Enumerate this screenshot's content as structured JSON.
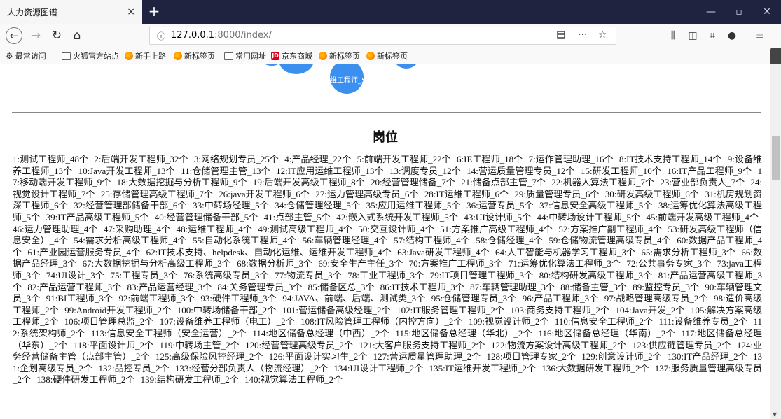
{
  "browser": {
    "tab_title": "人力资源图谱",
    "tab_close": "×",
    "new_tab": "+",
    "url_host": "127.0.0.1",
    "url_path": ":8000/index/",
    "window_min": "—",
    "window_restore": "▫",
    "window_close": "✕"
  },
  "bookmarks": [
    {
      "label": "最常访问",
      "icon": "gear-icon"
    },
    {
      "label": "火狐官方站点",
      "icon": "folder-icon"
    },
    {
      "label": "新手上路",
      "icon": "firefox-icon"
    },
    {
      "label": "新标签页",
      "icon": "firefox-icon"
    },
    {
      "label": "常用网址",
      "icon": "folder-icon"
    },
    {
      "label": "京东商城",
      "icon": "jd-icon"
    },
    {
      "label": "新标签页",
      "icon": "firefox-icon"
    },
    {
      "label": "新标签页",
      "icon": "firefox-icon"
    }
  ],
  "graph": {
    "node_label": "IT运维工程师_5个"
  },
  "section": {
    "title": "岗位"
  },
  "jobs": [
    "1:测试工程师_48个",
    "2:后端开发工程师_32个",
    "3:网络规划专员_25个",
    "4:产品经理_22个",
    "5:前端开发工程师_22个",
    "6:IE工程师_18个",
    "7:运作管理助理_16个",
    "8:IT技术支持工程师_14个",
    "9:设备维养工程师_13个",
    "10:Java开发工程师_13个",
    "11:仓储管理主管_13个",
    "12:IT应用运维工程师_13个",
    "13:调度专员_12个",
    "14:营运质量管理专员_12个",
    "15:研发工程师_10个",
    "16:IT产品工程师_9个",
    "17:移动端开发工程师_9个",
    "18:大数据挖掘与分析工程师_9个",
    "19:后端开发高级工程师_8个",
    "20:经营管理储备_7个",
    "21:储备点部主管_7个",
    "22:机器人算法工程师_7个",
    "23:营业部负责人_7个",
    "24:视觉设计工程师_7个",
    "25:存储管理高级工程师_7个",
    "26:java开发工程师_6个",
    "27:运力管理高级专员_6个",
    "28:IT运维工程师_6个",
    "29:质量管理专员_6个",
    "30:研发高级工程师_6个",
    "31:机房规划资深工程师_6个",
    "32:经营管理部储备干部_6个",
    "33:中转场经理_5个",
    "34:仓储管理经理_5个",
    "35:应用运维工程师_5个",
    "36:运营专员_5个",
    "37:信息安全高级工程师_5个",
    "38:运筹优化算法高级工程师_5个",
    "39:IT产品高级工程师_5个",
    "40:经营管理储备干部_5个",
    "41:点部主管_5个",
    "42:嵌入式系统开发工程师_5个",
    "43:UI设计师_5个",
    "44:中转场设计工程师_5个",
    "45:前端开发高级工程师_4个",
    "46:运力管理助理_4个",
    "47:采购助理_4个",
    "48:运维工程师_4个",
    "49:测试高级工程师_4个",
    "50:交互设计师_4个",
    "51:方案推广高级工程师_4个",
    "52:方案推广副工程师_4个",
    "53:研发高级工程师（信息安全）_4个",
    "54:需求分析高级工程师_4个",
    "55:自动化系统工程师_4个",
    "56:车辆管理经理_4个",
    "57:结构工程师_4个",
    "58:仓储经理_4个",
    "59:仓储物流管理高级专员_4个",
    "60:数据产品工程师_4个",
    "61:产业园运营服务专员_4个",
    "62:IT技术支持、helpdesk、自动化运维、运维开发工程师_4个",
    "63:Java研发工程师_4个",
    "64:人工智能与机器学习工程师_3个",
    "65:需求分析工程师_3个",
    "66:数据产品经理_3个",
    "67:大数据挖掘与分析高级工程师_3个",
    "68:数据分析师_3个",
    "69:安全生产主任_3个",
    "70:方案推广工程师_3个",
    "71:运筹优化算法工程师_3个",
    "72:公共事务专家_3个",
    "73:java工程师_3个",
    "74:UI设计_3个",
    "75:工程专员_3个",
    "76:系统高级专员_3个",
    "77:物流专员_3个",
    "78:工业工程师_3个",
    "79:IT项目管理工程师_3个",
    "80:结构研发高级工程师_3个",
    "81:产品运营高级工程师_3个",
    "82:产品运营工程师_3个",
    "83:产品运营经理_3个",
    "84:关务管理专员_3个",
    "85:储备区总_3个",
    "86:IT技术工程师_3个",
    "87:车辆管理助理_3个",
    "88:储备主管_3个",
    "89:监控专员_3个",
    "90:车辆管理文员_3个",
    "91:BI工程师_3个",
    "92:前端工程师_3个",
    "93:硬件工程师_3个",
    "94:JAVA、前端、后端、测试类_3个",
    "95:仓储管理专员_3个",
    "96:产品工程师_3个",
    "97:战略管理高级专员_2个",
    "98:造价高级工程师_2个",
    "99:Android开发工程师_2个",
    "100:中转场储备干部_2个",
    "101:营运储备高级经理_2个",
    "102:IT服务管理工程师_2个",
    "103:商务支持工程师_2个",
    "104:Java开发_2个",
    "105:解决方案高级工程师_2个",
    "106:项目管理总监_2个",
    "107:设备维养工程师（电工）_2个",
    "108:IT风险管理工程师（内控方向）_2个",
    "109:视觉设计师_2个",
    "110:信息安全工程师_2个",
    "111:设备维养专员_2个",
    "112:系统架构师_2个",
    "113:信息安全工程师（安全运营）_2个",
    "114:地区储备总经理（中西）_2个",
    "115:地区储备总经理（华北）_2个",
    "116:地区储备总经理（华南）_2个",
    "117:地区储备总经理（华东）_2个",
    "118:平面设计师_2个",
    "119:中转场主管_2个",
    "120:经营管理高级专员_2个",
    "121:大客户服务支持工程师_2个",
    "122:物流方案设计高级工程师_2个",
    "123:供应链管理专员_2个",
    "124:业务经营储备主管（点部主管）_2个",
    "125:高级保险风控经理_2个",
    "126:平面设计实习生_2个",
    "127:营运质量管理助理_2个",
    "128:项目管理专家_2个",
    "129:创意设计师_2个",
    "130:IT产品经理_2个",
    "131:企划高级专员_2个",
    "132:品控专员_2个",
    "133:经营分部负责人（物流经理）_2个",
    "134:UI设计工程师_2个",
    "135:IT运维开发工程师_2个",
    "136:大数据研发工程师_2个",
    "137:服务质量管理高级专员_2个",
    "138:硬件研发工程师_2个",
    "139:结构研发工程师_2个",
    "140:视觉算法工程师_2个"
  ]
}
